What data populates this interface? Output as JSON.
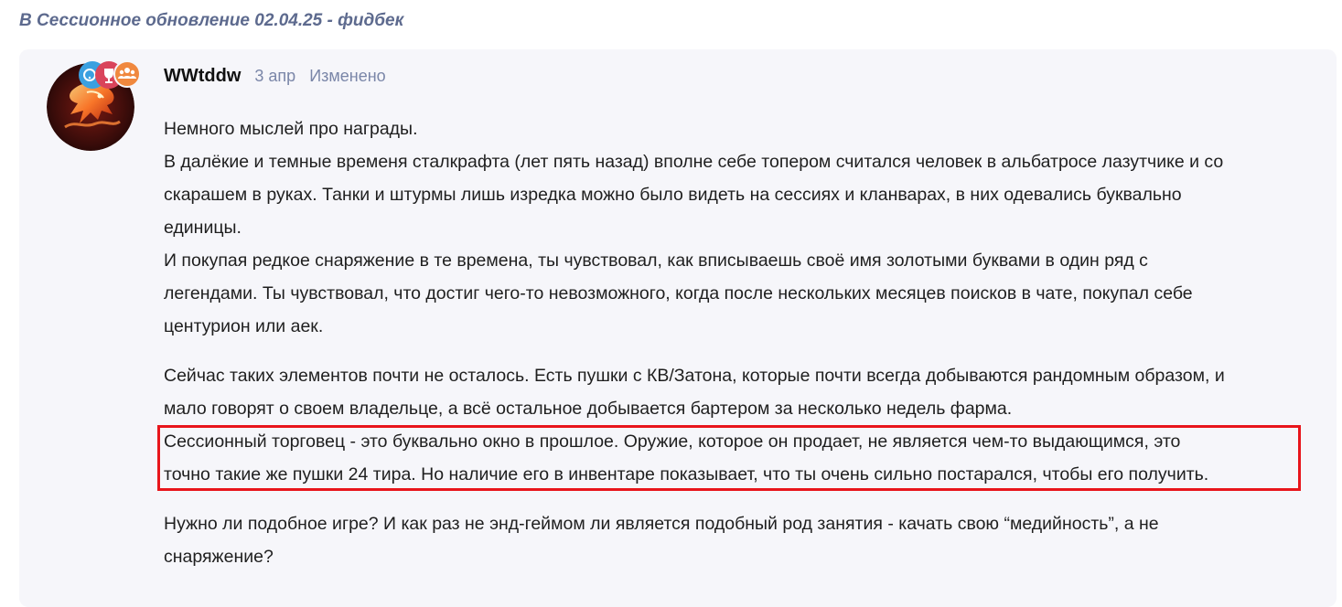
{
  "breadcrumb": {
    "prefix": "В",
    "topic": "Сессионное обновление 02.04.25 - фидбек"
  },
  "post": {
    "author": "WWtddw",
    "date": "3 апр",
    "edited_label": "Изменено",
    "badges": [
      "question-badge-icon",
      "trophy-badge-icon",
      "group-badge-icon"
    ],
    "lines": [
      "Немного мыслей про награды.",
      "В далёкие и темные временя сталкрафта (лет пять назад) вполне себе топером считался человек в альбатросе лазутчике и со",
      "скарашем в руках. Танки и штурмы лишь изредка можно было видеть на сессиях и кланварах, в них одевались буквально",
      "единицы.",
      "И покупая редкое снаряжение в те времена, ты чувствовал, как вписываешь своё имя золотыми буквами в один ряд с",
      "легендами. Ты чувствовал, что достиг чего-то невозможного, когда после нескольких месяцев поисков в чате, покупал себе",
      "центурион или аек.",
      "Сейчас таких элементов почти не осталось. Есть пушки с КВ/Затона, которые почти всегда добываются рандомным образом, и",
      "мало говорят о своем владельце, а всё остальное добывается бартером за несколько недель фарма.",
      "Сессионный торговец - это буквально окно в прошлое. Оружие, которое он продает, не является чем-то выдающимся, это",
      "точно такие же пушки 24 тира. Но наличие его в инвентаре показывает, что ты очень сильно постарался, чтобы его получить.",
      "Нужно ли подобное игре? И как раз не энд-геймом ли является подобный род занятия - качать свою “медийность”, а не",
      "снаряжение?"
    ]
  },
  "colors": {
    "breadcrumb": "#5d6a8e",
    "meta": "#7a86a8",
    "card_background": "#f6f6fa",
    "highlight_border": "#e8151b"
  }
}
